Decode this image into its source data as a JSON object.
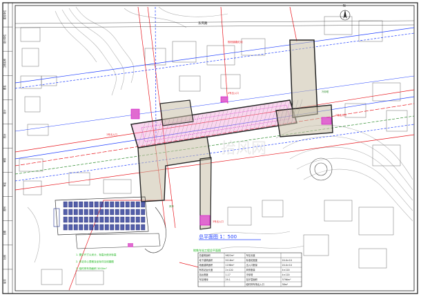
{
  "drawing": {
    "title_text": "总平面图  1：500",
    "subtitle_text": "地铁车站工程总平面图",
    "watermark_text": "拾风网",
    "north_arrow_label": "N",
    "colors": {
      "border": "#1a1a1a",
      "contour": "#b0b0b0",
      "road_red": "#e8141b",
      "rail_blue": "#1c3cff",
      "station_outline": "#222222",
      "concourse_pink": "#f08cd2",
      "platform_grey": "#c8c0a8",
      "parking_navy": "#1a2a8c",
      "magenta": "#d000c8",
      "note_green": "#18b418",
      "accent_cyan": "#00a0c8",
      "legend_frame": "#333333"
    }
  },
  "left_strip_labels": [
    "建设单位",
    "设计单位",
    "工程名称",
    "图名",
    "设计",
    "校对",
    "审核",
    "审定",
    "图号",
    "日期",
    "比例",
    "版次"
  ],
  "top_labels": [
    "东风路",
    "规划道路红线"
  ],
  "entrance_labels": [
    "1号出入口",
    "2号出入口",
    "3号出入口",
    "4号出入口",
    "风亭",
    "冷却塔"
  ],
  "notes": [
    "1. 图中尺寸以米计，标高为绝对标高",
    "2. 车站中心里程及坐标详见线路图",
    "3. 临时停车场面积  3000m²"
  ],
  "stats_table": {
    "rows": [
      [
        "总建筑面积",
        "9822m²",
        "车站长度",
        ""
      ],
      [
        "地下建筑面积",
        "9116m²",
        "标准段宽度",
        "20.0×10"
      ],
      [
        "地面建筑面积",
        "1196m²",
        "出入口数量",
        "20.0×10"
      ],
      [
        "有效站台长度",
        "2×120",
        "风亭数量",
        "4×120"
      ],
      [
        "站台宽度",
        "1.17",
        "冷却塔",
        "4×120"
      ],
      [
        "车站埋深",
        "29.1",
        "站厅层面积",
        "3796m²"
      ],
      [
        "",
        "",
        "临时停车场出入口",
        "38m²"
      ]
    ]
  }
}
